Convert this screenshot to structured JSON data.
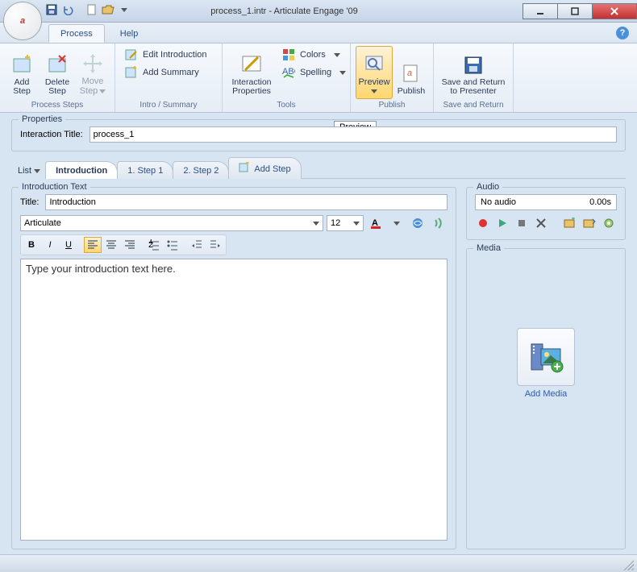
{
  "window": {
    "title": "process_1.intr - Articulate Engage '09"
  },
  "orb_letter": "a",
  "ribbon_tabs": {
    "process": "Process",
    "help": "Help"
  },
  "ribbon": {
    "process_steps": {
      "add_step": "Add\nStep",
      "delete_step": "Delete\nStep",
      "move_step": "Move\nStep",
      "group": "Process Steps"
    },
    "intro_summary": {
      "edit_intro": "Edit Introduction",
      "add_summary": "Add Summary",
      "group": "Intro / Summary"
    },
    "tools": {
      "interaction_props": "Interaction\nProperties",
      "colors": "Colors",
      "spelling": "Spelling",
      "group": "Tools"
    },
    "publish": {
      "preview": "Preview",
      "publish": "Publish",
      "group": "Publish"
    },
    "save_return": {
      "save_return": "Save and Return\nto Presenter",
      "group": "Save and Return"
    }
  },
  "tooltip_preview": "Preview",
  "properties": {
    "legend": "Properties",
    "label_title": "Interaction Title:",
    "value_title": "process_1"
  },
  "doctabs": {
    "list": "List",
    "introduction": "Introduction",
    "step1": "1. Step 1",
    "step2": "2. Step 2",
    "addstep": "Add Step"
  },
  "intro": {
    "legend": "Introduction Text",
    "title_label": "Title:",
    "title_value": "Introduction",
    "font": "Articulate",
    "size": "12",
    "placeholder": "Type your introduction text here."
  },
  "audio": {
    "legend": "Audio",
    "status": "No audio",
    "time": "0.00s"
  },
  "media": {
    "legend": "Media",
    "add": "Add Media"
  }
}
